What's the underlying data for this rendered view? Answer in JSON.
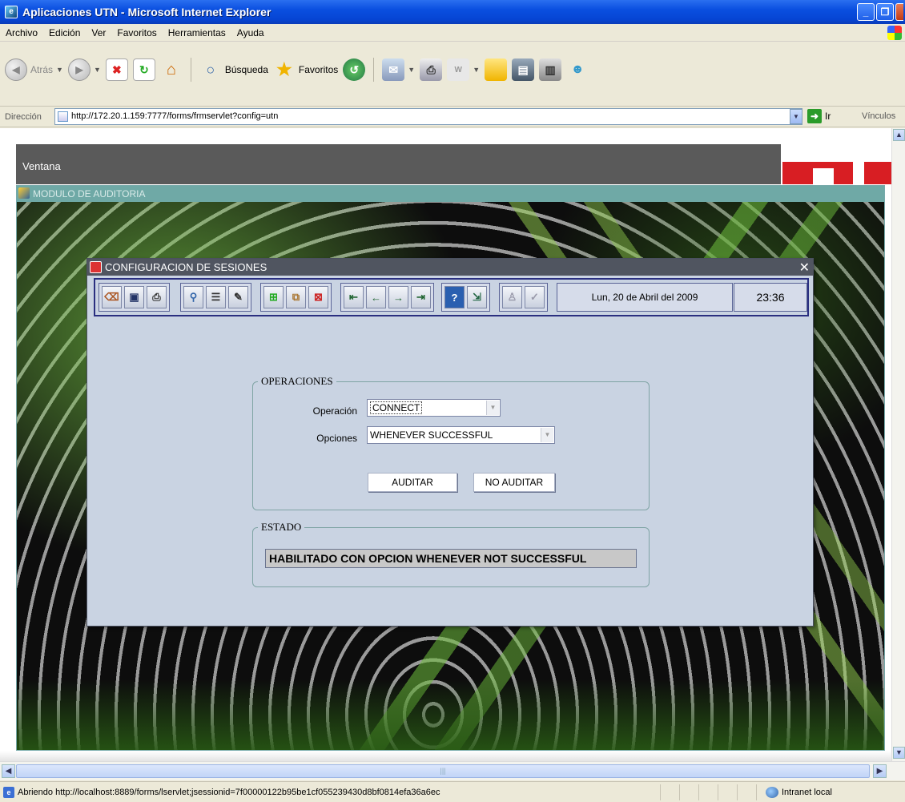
{
  "window": {
    "title": "Aplicaciones UTN - Microsoft Internet Explorer"
  },
  "menu": [
    "Archivo",
    "Edición",
    "Ver",
    "Favoritos",
    "Herramientas",
    "Ayuda"
  ],
  "toolbar": {
    "back": "Atrás",
    "search": "Búsqueda",
    "favorites": "Favoritos"
  },
  "address": {
    "label": "Dirección",
    "url": "http://172.20.1.159:7777/forms/frmservlet?config=utn",
    "go": "Ir",
    "links": "Vínculos"
  },
  "app": {
    "menu_window": "Ventana",
    "mdi_title": "MODULO DE AUDITORIA"
  },
  "dialog": {
    "title": "CONFIGURACION DE SESIONES",
    "date": "Lun, 20 de Abril del 2009",
    "time": "23:36",
    "operaciones": {
      "legend": "OPERACIONES",
      "operacion_label": "Operación",
      "operacion_value": "CONNECT",
      "opciones_label": "Opciones",
      "opciones_value": "WHENEVER SUCCESSFUL",
      "auditar": "AUDITAR",
      "no_auditar": "NO AUDITAR"
    },
    "estado": {
      "legend": "ESTADO",
      "value": "HABILITADO CON OPCION WHENEVER NOT SUCCESSFUL"
    }
  },
  "status": {
    "message": "Abriendo http://localhost:8889/forms/lservlet;jsessionid=7f00000122b95be1cf055239430d8bf0814efa36a6ec",
    "zone": "Intranet local"
  },
  "colors": {
    "titlebar": "#0a4fe0",
    "dialog_bg": "#c9d3e2",
    "utn_red": "#d81e23"
  }
}
